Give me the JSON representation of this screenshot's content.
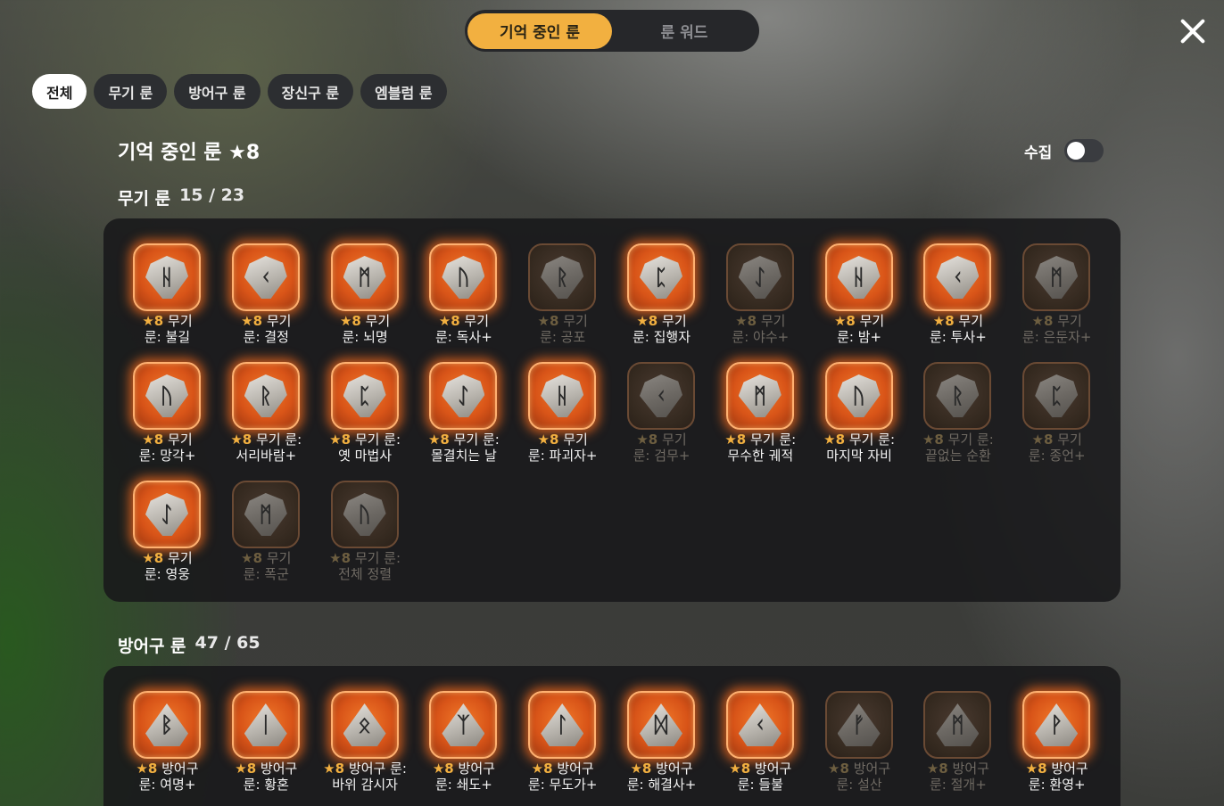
{
  "top_tabs": [
    {
      "label": "기억 중인 룬",
      "active": true
    },
    {
      "label": "룬 워드",
      "active": false
    }
  ],
  "close_icon": "close-icon",
  "filters": [
    {
      "label": "전체",
      "active": true
    },
    {
      "label": "무기 룬",
      "active": false
    },
    {
      "label": "방어구 룬",
      "active": false
    },
    {
      "label": "장신구 룬",
      "active": false
    },
    {
      "label": "엠블럼 룬",
      "active": false
    }
  ],
  "heading": "기억 중인 룬 ★8",
  "collect": {
    "label": "수집",
    "on": false
  },
  "sections": [
    {
      "name": "무기 룬",
      "count": "15 / 23",
      "runes": [
        {
          "glyph": "ᚺ",
          "star": "★8",
          "line1": "무기",
          "line2": "룬: 불길",
          "on": true
        },
        {
          "glyph": "ᚲ",
          "star": "★8",
          "line1": "무기",
          "line2": "룬: 결정",
          "on": true
        },
        {
          "glyph": "ᛗ",
          "star": "★8",
          "line1": "무기",
          "line2": "룬: 뇌명",
          "on": true
        },
        {
          "glyph": "ᚢ",
          "star": "★8",
          "line1": "무기",
          "line2": "룬: 독사+",
          "on": true
        },
        {
          "glyph": "ᚱ",
          "star": "★8",
          "line1": "무기",
          "line2": "룬: 공포",
          "on": false
        },
        {
          "glyph": "ᛈ",
          "star": "★8",
          "line1": "무기",
          "line2": "룬: 집행자",
          "on": true
        },
        {
          "glyph": "ᛇ",
          "star": "★8",
          "line1": "무기",
          "line2": "룬: 야수+",
          "on": false
        },
        {
          "glyph": "ᚺ",
          "star": "★8",
          "line1": "무기",
          "line2": "룬: 밤+",
          "on": true
        },
        {
          "glyph": "ᚲ",
          "star": "★8",
          "line1": "무기",
          "line2": "룬: 투사+",
          "on": true
        },
        {
          "glyph": "ᛗ",
          "star": "★8",
          "line1": "무기",
          "line2": "룬: 은둔자+",
          "on": false
        },
        {
          "glyph": "ᚢ",
          "star": "★8",
          "line1": "무기",
          "line2": "룬: 망각+",
          "on": true
        },
        {
          "glyph": "ᚱ",
          "star": "★8",
          "line1": "무기 룬:",
          "line2": "서리바람+",
          "on": true
        },
        {
          "glyph": "ᛈ",
          "star": "★8",
          "line1": "무기 룬:",
          "line2": "옛 마법사",
          "on": true
        },
        {
          "glyph": "ᛇ",
          "star": "★8",
          "line1": "무기 룬:",
          "line2": "몰결치는 날",
          "on": true
        },
        {
          "glyph": "ᚺ",
          "star": "★8",
          "line1": "무기",
          "line2": "룬: 파괴자+",
          "on": true
        },
        {
          "glyph": "ᚲ",
          "star": "★8",
          "line1": "무기",
          "line2": "룬: 검무+",
          "on": false
        },
        {
          "glyph": "ᛗ",
          "star": "★8",
          "line1": "무기 룬:",
          "line2": "무수한 궤적",
          "on": true
        },
        {
          "glyph": "ᚢ",
          "star": "★8",
          "line1": "무기 룬:",
          "line2": "마지막 자비",
          "on": true
        },
        {
          "glyph": "ᚱ",
          "star": "★8",
          "line1": "무기 룬:",
          "line2": "끝없는 순환",
          "on": false
        },
        {
          "glyph": "ᛈ",
          "star": "★8",
          "line1": "무기",
          "line2": "룬: 종언+",
          "on": false
        },
        {
          "glyph": "ᛇ",
          "star": "★8",
          "line1": "무기",
          "line2": "룬: 영웅",
          "on": true
        },
        {
          "glyph": "ᛗ",
          "star": "★8",
          "line1": "무기",
          "line2": "룬: 폭군",
          "on": false
        },
        {
          "glyph": "ᚢ",
          "star": "★8",
          "line1": "무기 룬:",
          "line2": "전체 정렬",
          "on": false
        }
      ]
    },
    {
      "name": "방어구 룬",
      "count": "47 / 65",
      "runes": [
        {
          "glyph": "ᛒ",
          "star": "★8",
          "line1": "방어구",
          "line2": "룬: 여명+",
          "on": true
        },
        {
          "glyph": "ᛁ",
          "star": "★8",
          "line1": "방어구",
          "line2": "룬: 황혼",
          "on": true
        },
        {
          "glyph": "ᛟ",
          "star": "★8",
          "line1": "방어구 룬:",
          "line2": "바위 감시자",
          "on": true
        },
        {
          "glyph": "ᛉ",
          "star": "★8",
          "line1": "방어구",
          "line2": "룬: 쇄도+",
          "on": true
        },
        {
          "glyph": "ᛚ",
          "star": "★8",
          "line1": "방어구",
          "line2": "룬: 무도가+",
          "on": true
        },
        {
          "glyph": "ᛞ",
          "star": "★8",
          "line1": "방어구",
          "line2": "룬: 해결사+",
          "on": true
        },
        {
          "glyph": "ᚲ",
          "star": "★8",
          "line1": "방어구",
          "line2": "룬: 들불",
          "on": true
        },
        {
          "glyph": "ᚠ",
          "star": "★8",
          "line1": "방어구",
          "line2": "룬: 설산",
          "on": false
        },
        {
          "glyph": "ᛗ",
          "star": "★8",
          "line1": "방어구",
          "line2": "룬: 절개+",
          "on": false
        },
        {
          "glyph": "ᚹ",
          "star": "★8",
          "line1": "방어구",
          "line2": "룬: 환영+",
          "on": true
        }
      ]
    }
  ]
}
